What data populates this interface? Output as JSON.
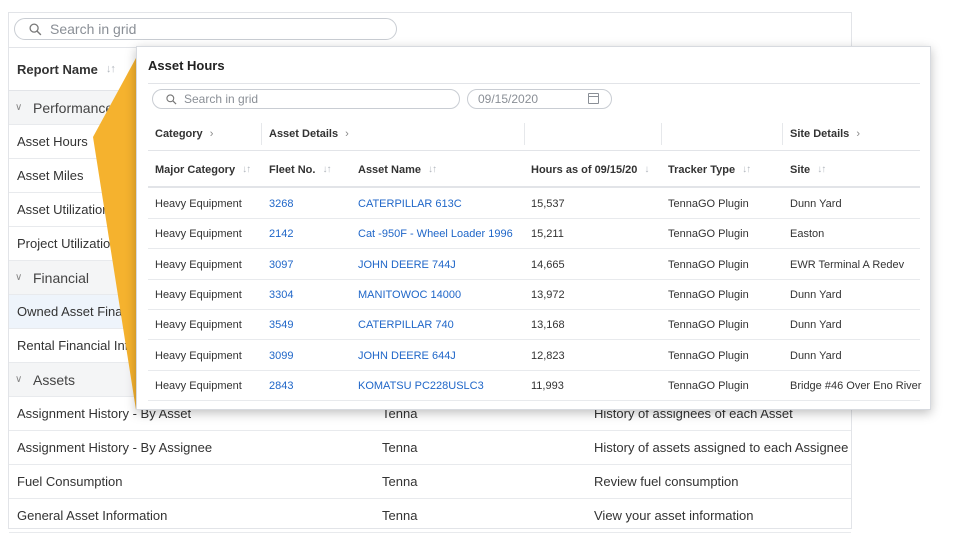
{
  "background_grid": {
    "search_placeholder": "Search in grid",
    "header": {
      "report_name_label": "Report Name"
    },
    "rows": [
      {
        "kind": "group",
        "label": "Performance"
      },
      {
        "kind": "item",
        "label": "Asset Hours"
      },
      {
        "kind": "item",
        "label": "Asset Miles"
      },
      {
        "kind": "item",
        "label": "Asset Utilization By Asset"
      },
      {
        "kind": "item",
        "label": "Project Utilization"
      },
      {
        "kind": "group",
        "label": "Financial"
      },
      {
        "kind": "item",
        "label": "Owned Asset Financial Information",
        "selected": true
      },
      {
        "kind": "item",
        "label": "Rental Financial Information"
      },
      {
        "kind": "group",
        "label": "Assets"
      },
      {
        "kind": "item",
        "label": "Assignment History - By Asset",
        "source": "Tenna",
        "description": "History of assignees of each Asset"
      },
      {
        "kind": "item",
        "label": "Assignment History - By Assignee",
        "source": "Tenna",
        "description": "History of assets assigned to each Assignee"
      },
      {
        "kind": "item",
        "label": "Fuel Consumption",
        "source": "Tenna",
        "description": "Review fuel consumption"
      },
      {
        "kind": "item",
        "label": "General Asset Information",
        "source": "Tenna",
        "description": "View your asset information"
      }
    ]
  },
  "popup": {
    "title": "Asset Hours",
    "search_placeholder": "Search in grid",
    "date_value": "09/15/2020",
    "column_groups": {
      "category": "Category",
      "asset_details": "Asset Details",
      "site_details": "Site Details"
    },
    "columns": {
      "major_category": "Major Category",
      "fleet_no": "Fleet No.",
      "asset_name": "Asset Name",
      "hours": "Hours as of 09/15/20",
      "tracker_type": "Tracker Type",
      "site": "Site"
    },
    "rows": [
      {
        "major_category": "Heavy Equipment",
        "fleet_no": "3268",
        "asset_name": "CATERPILLAR 613C",
        "hours": "15,537",
        "tracker_type": "TennaGO Plugin",
        "site": "Dunn Yard"
      },
      {
        "major_category": "Heavy Equipment",
        "fleet_no": "2142",
        "asset_name": "Cat -950F - Wheel Loader 1996",
        "hours": "15,211",
        "tracker_type": "TennaGO Plugin",
        "site": "Easton"
      },
      {
        "major_category": "Heavy Equipment",
        "fleet_no": "3097",
        "asset_name": "JOHN DEERE 744J",
        "hours": "14,665",
        "tracker_type": "TennaGO Plugin",
        "site": "EWR Terminal A Redev"
      },
      {
        "major_category": "Heavy Equipment",
        "fleet_no": "3304",
        "asset_name": "MANITOWOC 14000",
        "hours": "13,972",
        "tracker_type": "TennaGO Plugin",
        "site": "Dunn Yard"
      },
      {
        "major_category": "Heavy Equipment",
        "fleet_no": "3549",
        "asset_name": "CATERPILLAR 740",
        "hours": "13,168",
        "tracker_type": "TennaGO Plugin",
        "site": "Dunn Yard"
      },
      {
        "major_category": "Heavy Equipment",
        "fleet_no": "3099",
        "asset_name": "JOHN DEERE 644J",
        "hours": "12,823",
        "tracker_type": "TennaGO Plugin",
        "site": "Dunn Yard"
      },
      {
        "major_category": "Heavy Equipment",
        "fleet_no": "2843",
        "asset_name": "KOMATSU PC228USLC3",
        "hours": "11,993",
        "tracker_type": "TennaGO Plugin",
        "site": "Bridge #46 Over Eno River"
      }
    ]
  },
  "colors": {
    "accent_yellow": "#f5b22e",
    "link_blue": "#1f66c8",
    "group_row_bg": "#f4f5f6",
    "selected_row_bg": "#eef4fb"
  }
}
